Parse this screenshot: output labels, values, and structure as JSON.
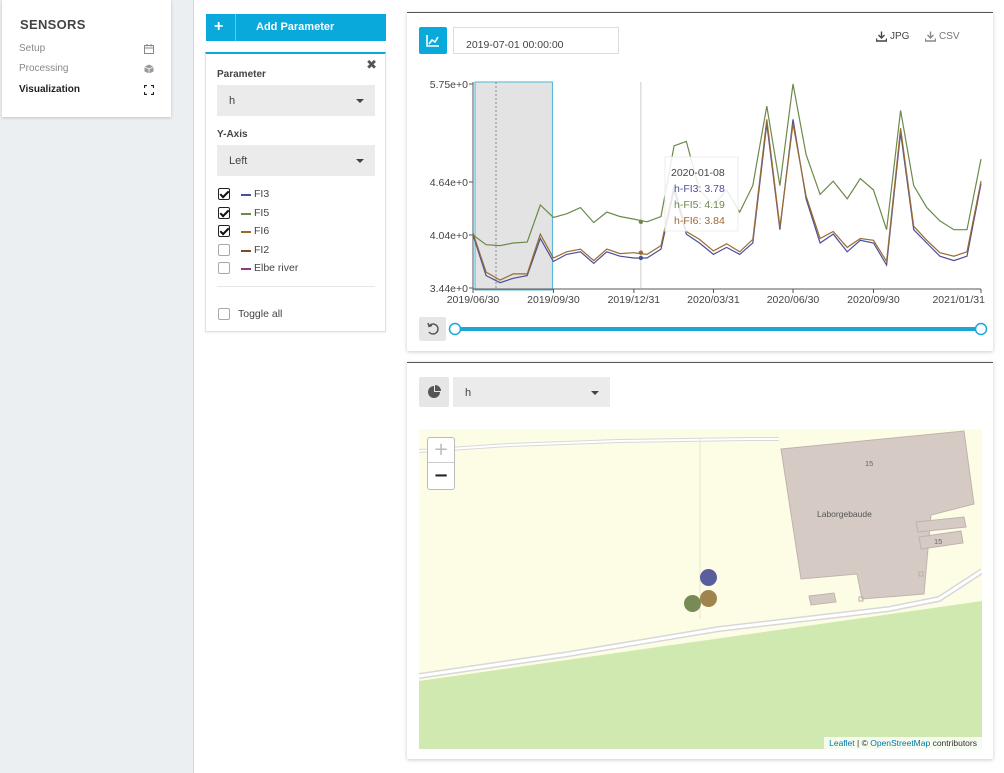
{
  "nav": {
    "title": "SENSORS",
    "items": [
      {
        "label": "Setup",
        "icon": "calendar-icon"
      },
      {
        "label": "Processing",
        "icon": "cube-icon"
      },
      {
        "label": "Visualization",
        "icon": "expand-icon",
        "active": true
      }
    ]
  },
  "add_parameter": {
    "label": "Add Parameter",
    "icon": "plus-icon"
  },
  "param_panel": {
    "parameter_label": "Parameter",
    "parameter_value": "h",
    "yaxis_label": "Y-Axis",
    "yaxis_value": "Left",
    "sensors": [
      {
        "label": "FI3",
        "checked": true,
        "color": "#4b4f9a"
      },
      {
        "label": "FI5",
        "checked": true,
        "color": "#6b8a4a"
      },
      {
        "label": "FI6",
        "checked": true,
        "color": "#9a6b2f"
      },
      {
        "label": "FI2",
        "checked": false,
        "color": "#7a4a2a"
      },
      {
        "label": "Elbe river",
        "checked": false,
        "color": "#8a3a8a"
      }
    ],
    "toggle_all_label": "Toggle all"
  },
  "chart_toolbar": {
    "date_value": "2019-07-01 00:00:00",
    "jpg_label": "JPG",
    "csv_label": "CSV"
  },
  "chart_data": {
    "type": "line",
    "x_ticks": [
      "2019/06/30",
      "2019/09/30",
      "2019/12/31",
      "2020/03/31",
      "2020/06/30",
      "2020/09/30",
      "2021/01/31"
    ],
    "y_ticks": [
      "5.75e+0",
      "4.64e+0",
      "4.04e+0",
      "3.44e+0"
    ],
    "ylim": [
      3.44,
      5.75
    ],
    "x": [
      "2019/06/30",
      "2019/07/15",
      "2019/07/31",
      "2019/08/15",
      "2019/08/31",
      "2019/09/15",
      "2019/09/30",
      "2019/10/15",
      "2019/10/31",
      "2019/11/15",
      "2019/11/30",
      "2019/12/15",
      "2019/12/31",
      "2020/01/15",
      "2020/01/31",
      "2020/02/15",
      "2020/02/29",
      "2020/03/15",
      "2020/03/31",
      "2020/04/15",
      "2020/04/30",
      "2020/05/15",
      "2020/05/31",
      "2020/06/15",
      "2020/06/30",
      "2020/07/15",
      "2020/07/31",
      "2020/08/15",
      "2020/08/31",
      "2020/09/15",
      "2020/09/30",
      "2020/10/15",
      "2020/10/31",
      "2020/11/15",
      "2020/11/30",
      "2020/12/15",
      "2020/12/31",
      "2021/01/15",
      "2021/01/31"
    ],
    "series": [
      {
        "name": "FI5",
        "color": "#6b8a4a",
        "values": [
          4.04,
          3.93,
          3.92,
          3.95,
          3.96,
          4.38,
          4.24,
          4.28,
          4.35,
          4.18,
          4.3,
          4.25,
          4.22,
          4.19,
          4.25,
          5.05,
          5.1,
          4.55,
          4.38,
          4.55,
          4.3,
          4.6,
          5.5,
          4.6,
          5.75,
          4.95,
          4.5,
          4.65,
          4.45,
          4.68,
          4.55,
          4.1,
          5.45,
          4.6,
          4.35,
          4.2,
          4.1,
          4.1,
          4.9
        ]
      },
      {
        "name": "FI3",
        "color": "#4b4f9a",
        "values": [
          4.04,
          3.58,
          3.5,
          3.55,
          3.58,
          4.0,
          3.74,
          3.82,
          3.85,
          3.72,
          3.85,
          3.8,
          3.78,
          3.78,
          3.88,
          4.55,
          4.05,
          3.95,
          3.82,
          3.9,
          3.82,
          3.95,
          5.3,
          4.1,
          5.35,
          4.45,
          3.95,
          4.05,
          3.85,
          3.98,
          3.95,
          3.7,
          5.2,
          4.1,
          3.95,
          3.8,
          3.75,
          3.8,
          4.62
        ]
      },
      {
        "name": "FI6",
        "color": "#9a6b2f",
        "values": [
          4.06,
          3.62,
          3.53,
          3.6,
          3.6,
          4.05,
          3.78,
          3.85,
          3.88,
          3.75,
          3.88,
          3.83,
          3.84,
          3.82,
          3.92,
          4.6,
          4.08,
          3.99,
          3.86,
          3.94,
          3.85,
          3.99,
          5.35,
          4.13,
          5.3,
          4.48,
          4.0,
          4.08,
          3.9,
          4.0,
          3.98,
          3.74,
          5.25,
          4.14,
          3.98,
          3.84,
          3.8,
          3.85,
          4.65
        ]
      }
    ],
    "tooltip": {
      "date": "2020-01-08",
      "lines": [
        "h-FI3: 3.78",
        "h-FI5: 4.19",
        "h-FI6: 3.84"
      ]
    },
    "selection_x": [
      "2019/06/30",
      "2019/09/30"
    ],
    "marker_x": "2019/06/30"
  },
  "map_panel": {
    "select_value": "h",
    "type_icon": "pie-chart-icon",
    "zoom_in": "+",
    "zoom_out": "−",
    "building_label": "Laborgebaude",
    "house_numbers": [
      "15",
      "15"
    ],
    "attribution": {
      "leaflet": "Leaflet",
      "sep": " | © ",
      "osm": "OpenStreetMap",
      "contrib": " contributors"
    },
    "markers": [
      {
        "name": "FI3",
        "color": "#5a5e9e"
      },
      {
        "name": "FI5",
        "color": "#788b56"
      },
      {
        "name": "FI6",
        "color": "#a0844e"
      }
    ]
  }
}
